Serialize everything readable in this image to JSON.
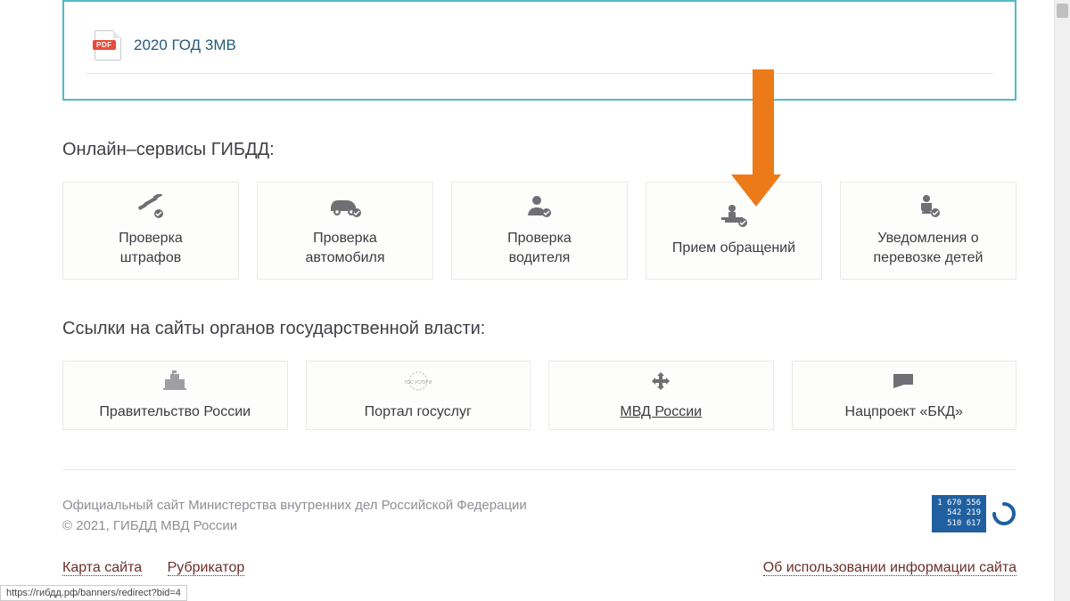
{
  "doc": {
    "pdf_badge": "PDF",
    "file": "2020 ГОД 3МВ"
  },
  "services": {
    "title": "Онлайн–сервисы ГИБДД:",
    "items": [
      {
        "line1": "Проверка",
        "line2": "штрафов"
      },
      {
        "line1": "Проверка",
        "line2": "автомобиля"
      },
      {
        "line1": "Проверка",
        "line2": "водителя"
      },
      {
        "line1": "Прием обращений",
        "line2": ""
      },
      {
        "line1": "Уведомления о",
        "line2": "перевозке детей"
      }
    ]
  },
  "gov": {
    "title": "Ссылки на сайты органов государственной власти:",
    "items": [
      {
        "label": "Правительство России"
      },
      {
        "label": "Портал госуслуг"
      },
      {
        "label": "МВД России"
      },
      {
        "label": "Нацпроект «БКД»"
      }
    ]
  },
  "footer": {
    "line1": "Официальный сайт Министерства внутренних дел Российской Федерации",
    "line2": "© 2021, ГИБДД МВД России",
    "counter": {
      "a": "1 670 556",
      "b": "542 219",
      "c": "510 617"
    },
    "sitemap": "Карта сайта",
    "rubricator": "Рубрикатор",
    "usage": "Об использовании информации сайта"
  },
  "status": "https://гибдд.рф/banners/redirect?bid=4"
}
